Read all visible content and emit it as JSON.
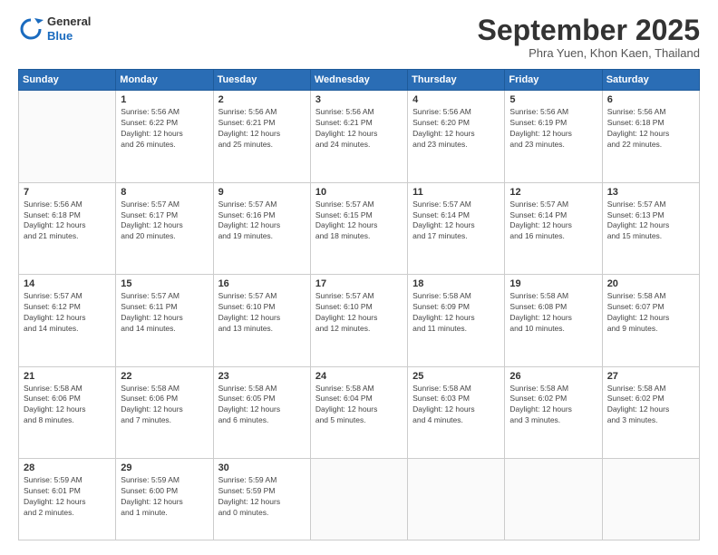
{
  "header": {
    "logo": {
      "general": "General",
      "blue": "Blue"
    },
    "title": "September 2025",
    "location": "Phra Yuen, Khon Kaen, Thailand"
  },
  "weekdays": [
    "Sunday",
    "Monday",
    "Tuesday",
    "Wednesday",
    "Thursday",
    "Friday",
    "Saturday"
  ],
  "weeks": [
    [
      {
        "num": "",
        "info": ""
      },
      {
        "num": "1",
        "info": "Sunrise: 5:56 AM\nSunset: 6:22 PM\nDaylight: 12 hours\nand 26 minutes."
      },
      {
        "num": "2",
        "info": "Sunrise: 5:56 AM\nSunset: 6:21 PM\nDaylight: 12 hours\nand 25 minutes."
      },
      {
        "num": "3",
        "info": "Sunrise: 5:56 AM\nSunset: 6:21 PM\nDaylight: 12 hours\nand 24 minutes."
      },
      {
        "num": "4",
        "info": "Sunrise: 5:56 AM\nSunset: 6:20 PM\nDaylight: 12 hours\nand 23 minutes."
      },
      {
        "num": "5",
        "info": "Sunrise: 5:56 AM\nSunset: 6:19 PM\nDaylight: 12 hours\nand 23 minutes."
      },
      {
        "num": "6",
        "info": "Sunrise: 5:56 AM\nSunset: 6:18 PM\nDaylight: 12 hours\nand 22 minutes."
      }
    ],
    [
      {
        "num": "7",
        "info": "Sunrise: 5:56 AM\nSunset: 6:18 PM\nDaylight: 12 hours\nand 21 minutes."
      },
      {
        "num": "8",
        "info": "Sunrise: 5:57 AM\nSunset: 6:17 PM\nDaylight: 12 hours\nand 20 minutes."
      },
      {
        "num": "9",
        "info": "Sunrise: 5:57 AM\nSunset: 6:16 PM\nDaylight: 12 hours\nand 19 minutes."
      },
      {
        "num": "10",
        "info": "Sunrise: 5:57 AM\nSunset: 6:15 PM\nDaylight: 12 hours\nand 18 minutes."
      },
      {
        "num": "11",
        "info": "Sunrise: 5:57 AM\nSunset: 6:14 PM\nDaylight: 12 hours\nand 17 minutes."
      },
      {
        "num": "12",
        "info": "Sunrise: 5:57 AM\nSunset: 6:14 PM\nDaylight: 12 hours\nand 16 minutes."
      },
      {
        "num": "13",
        "info": "Sunrise: 5:57 AM\nSunset: 6:13 PM\nDaylight: 12 hours\nand 15 minutes."
      }
    ],
    [
      {
        "num": "14",
        "info": "Sunrise: 5:57 AM\nSunset: 6:12 PM\nDaylight: 12 hours\nand 14 minutes."
      },
      {
        "num": "15",
        "info": "Sunrise: 5:57 AM\nSunset: 6:11 PM\nDaylight: 12 hours\nand 14 minutes."
      },
      {
        "num": "16",
        "info": "Sunrise: 5:57 AM\nSunset: 6:10 PM\nDaylight: 12 hours\nand 13 minutes."
      },
      {
        "num": "17",
        "info": "Sunrise: 5:57 AM\nSunset: 6:10 PM\nDaylight: 12 hours\nand 12 minutes."
      },
      {
        "num": "18",
        "info": "Sunrise: 5:58 AM\nSunset: 6:09 PM\nDaylight: 12 hours\nand 11 minutes."
      },
      {
        "num": "19",
        "info": "Sunrise: 5:58 AM\nSunset: 6:08 PM\nDaylight: 12 hours\nand 10 minutes."
      },
      {
        "num": "20",
        "info": "Sunrise: 5:58 AM\nSunset: 6:07 PM\nDaylight: 12 hours\nand 9 minutes."
      }
    ],
    [
      {
        "num": "21",
        "info": "Sunrise: 5:58 AM\nSunset: 6:06 PM\nDaylight: 12 hours\nand 8 minutes."
      },
      {
        "num": "22",
        "info": "Sunrise: 5:58 AM\nSunset: 6:06 PM\nDaylight: 12 hours\nand 7 minutes."
      },
      {
        "num": "23",
        "info": "Sunrise: 5:58 AM\nSunset: 6:05 PM\nDaylight: 12 hours\nand 6 minutes."
      },
      {
        "num": "24",
        "info": "Sunrise: 5:58 AM\nSunset: 6:04 PM\nDaylight: 12 hours\nand 5 minutes."
      },
      {
        "num": "25",
        "info": "Sunrise: 5:58 AM\nSunset: 6:03 PM\nDaylight: 12 hours\nand 4 minutes."
      },
      {
        "num": "26",
        "info": "Sunrise: 5:58 AM\nSunset: 6:02 PM\nDaylight: 12 hours\nand 3 minutes."
      },
      {
        "num": "27",
        "info": "Sunrise: 5:58 AM\nSunset: 6:02 PM\nDaylight: 12 hours\nand 3 minutes."
      }
    ],
    [
      {
        "num": "28",
        "info": "Sunrise: 5:59 AM\nSunset: 6:01 PM\nDaylight: 12 hours\nand 2 minutes."
      },
      {
        "num": "29",
        "info": "Sunrise: 5:59 AM\nSunset: 6:00 PM\nDaylight: 12 hours\nand 1 minute."
      },
      {
        "num": "30",
        "info": "Sunrise: 5:59 AM\nSunset: 5:59 PM\nDaylight: 12 hours\nand 0 minutes."
      },
      {
        "num": "",
        "info": ""
      },
      {
        "num": "",
        "info": ""
      },
      {
        "num": "",
        "info": ""
      },
      {
        "num": "",
        "info": ""
      }
    ]
  ]
}
